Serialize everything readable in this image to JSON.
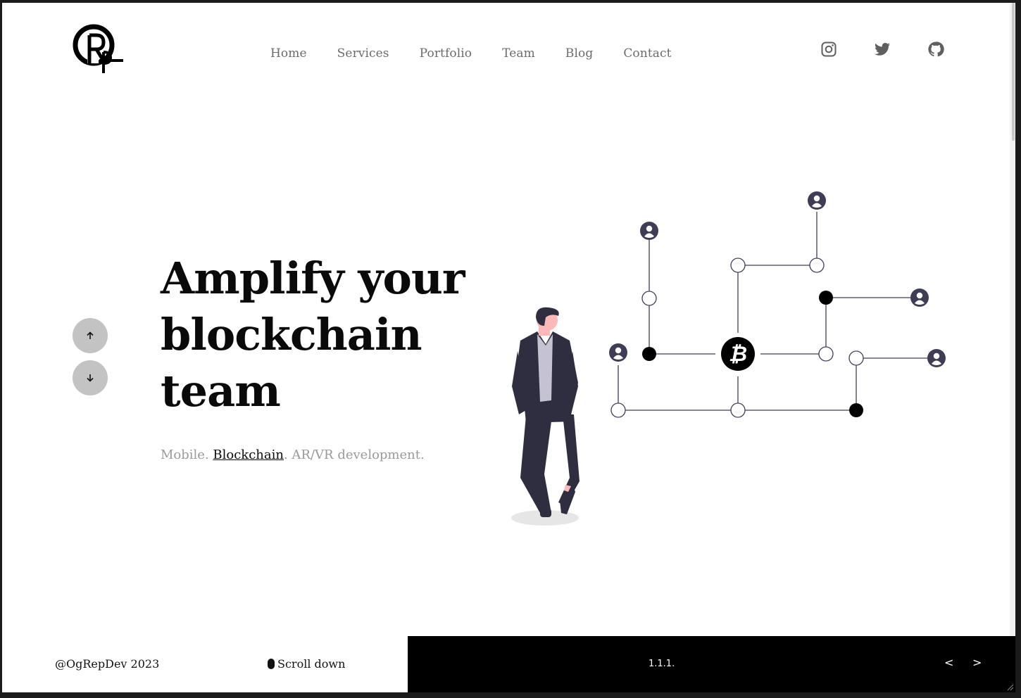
{
  "brand": {
    "logo_text": "ORP"
  },
  "nav": [
    "Home",
    "Services",
    "Portfolio",
    "Team",
    "Blog",
    "Contact"
  ],
  "socials": [
    "instagram-icon",
    "twitter-icon",
    "github-icon"
  ],
  "hero": {
    "title_line1": "Amplify your",
    "title_line2": "blockchain",
    "title_line3": "team",
    "sub_before": "Mobile. ",
    "sub_link": "Blockchain",
    "sub_after": ". AR/VR development."
  },
  "footer": {
    "copyright": "@OgRepDev 2023",
    "scroll_label": "Scroll down",
    "slide_number": "1.1.1.",
    "prev": "<",
    "next": ">"
  },
  "colors": {
    "accent": "#000000",
    "muted_text": "#9a9a9a",
    "nav_text": "#6b6b6b",
    "button_bg": "#c3c3c3",
    "illus_dark": "#3f3d56"
  }
}
